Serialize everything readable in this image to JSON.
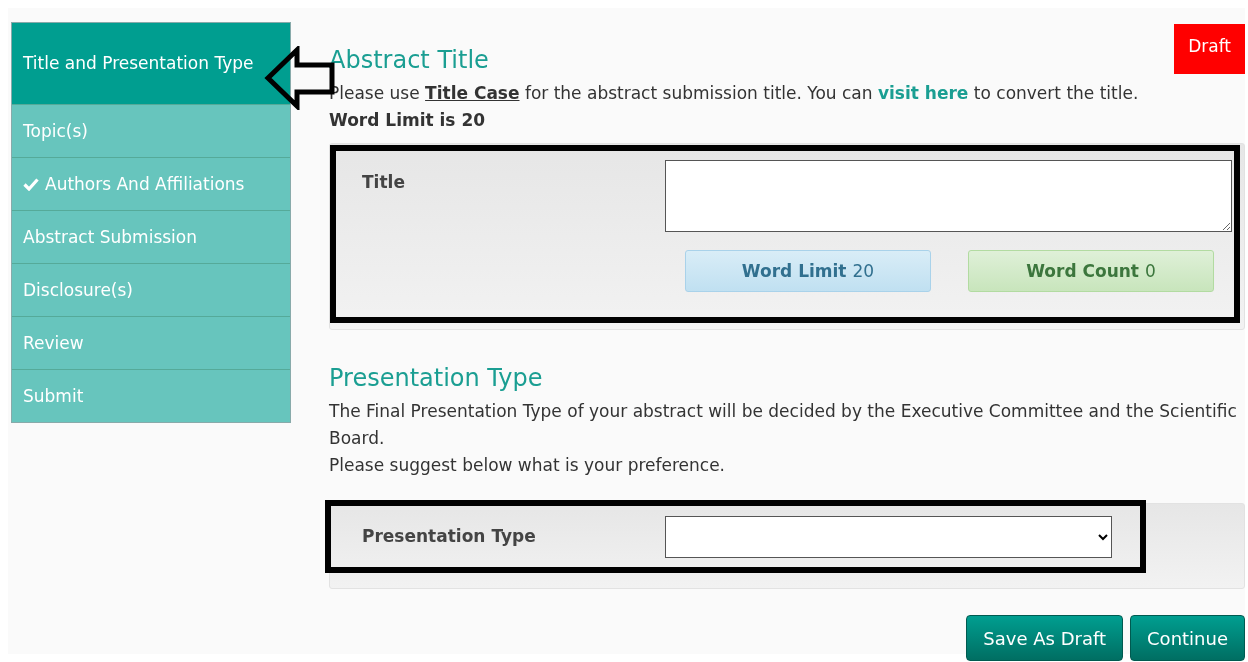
{
  "sidebar": {
    "items": [
      {
        "label": "Title and Presentation Type",
        "selected": true,
        "completed": false
      },
      {
        "label": "Topic(s)",
        "selected": false,
        "completed": false
      },
      {
        "label": "Authors And Affiliations",
        "selected": false,
        "completed": true
      },
      {
        "label": "Abstract Submission",
        "selected": false,
        "completed": false
      },
      {
        "label": "Disclosure(s)",
        "selected": false,
        "completed": false
      },
      {
        "label": "Review",
        "selected": false,
        "completed": false
      },
      {
        "label": "Submit",
        "selected": false,
        "completed": false
      }
    ]
  },
  "pointer_arrow": true,
  "status_badge": "Draft",
  "sections": [
    {
      "kind": "title",
      "heading": "Abstract Title",
      "highlighted": true,
      "intro": [
        "Please use **Title Case** for the abstract submission title. You can ",
        "visit here",
        " to convert the title."
      ],
      "limit_note": "Word Limit is 20",
      "field_label": "Title",
      "word_limit": "**Word Limit** 20",
      "word_count": "**Word Count** 0"
    },
    {
      "kind": "type",
      "heading": "Presentation Type",
      "highlighted": true,
      "paragraphs": [
        "The Final Presentation Type of your abstract will be decided by the Executive Committee and the Scientific Board.",
        "Please suggest below what is your preference."
      ],
      "field_label": "Presentation Type"
    }
  ],
  "buttons": [
    {
      "label": "Save As Draft"
    },
    {
      "label": "Continue"
    }
  ]
}
